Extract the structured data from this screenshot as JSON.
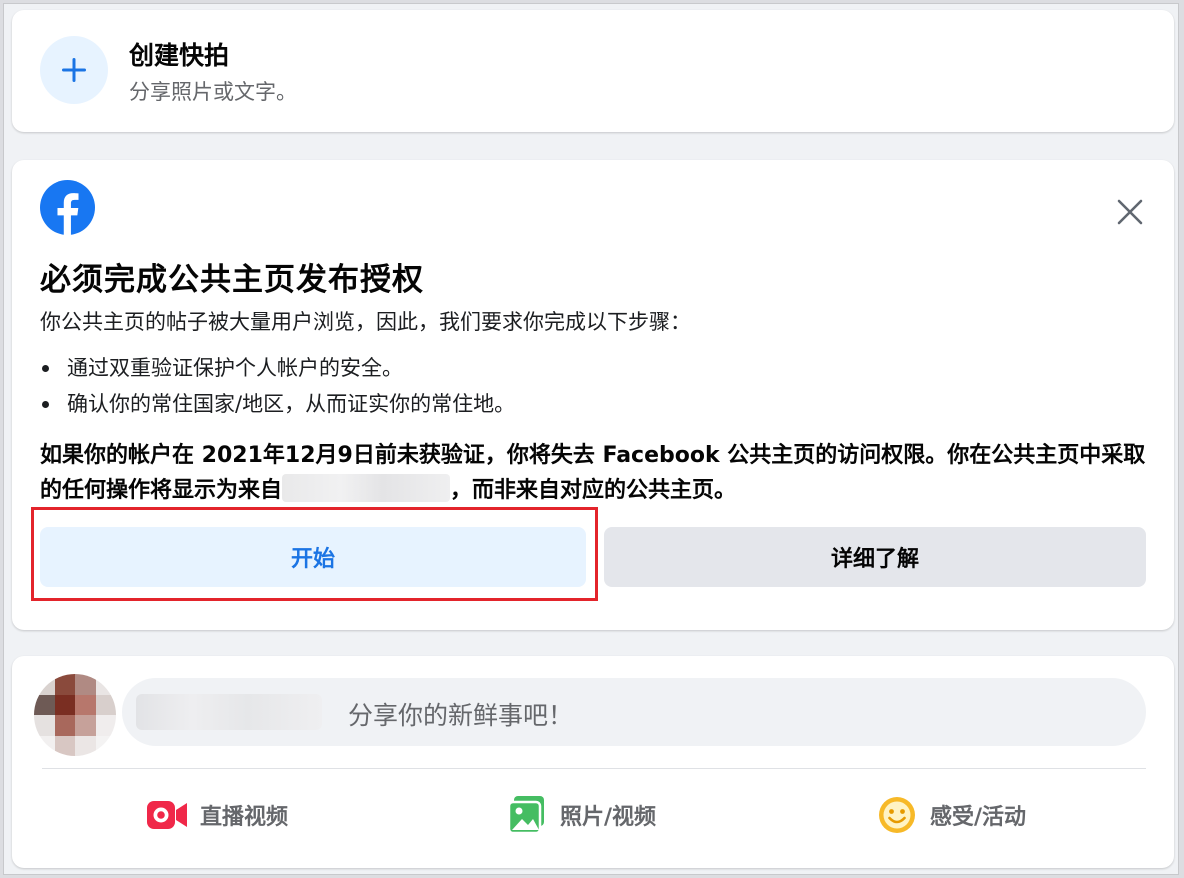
{
  "create_story": {
    "title": "创建快拍",
    "subtitle": "分享照片或文字。"
  },
  "prompt": {
    "title": "必须完成公共主页发布授权",
    "intro": "你公共主页的帖子被大量用户浏览，因此，我们要求你完成以下步骤：",
    "steps": [
      "通过双重验证保护个人帐户的安全。",
      "确认你的常住国家/地区，从而证实你的常住地。"
    ],
    "warning_part1": "如果你的帐户在 2021年12月9日前未获验证，你将失去 Facebook 公共主页的访问权限。你在公共主页中采取的任何操作将显示为来自",
    "warning_part2": "，而非来自对应的公共主页。",
    "start_label": "开始",
    "learn_more_label": "详细了解"
  },
  "composer": {
    "placeholder": "分享你的新鲜事吧！",
    "actions": [
      {
        "label": "直播视频",
        "icon": "live-video-icon",
        "color": "#f02849"
      },
      {
        "label": "照片/视频",
        "icon": "photo-video-icon",
        "color": "#45bd62"
      },
      {
        "label": "感受/活动",
        "icon": "feeling-activity-icon",
        "color": "#f7b928"
      }
    ]
  },
  "colors": {
    "accent": "#1b74e4",
    "highlight_border": "#e3242b"
  }
}
